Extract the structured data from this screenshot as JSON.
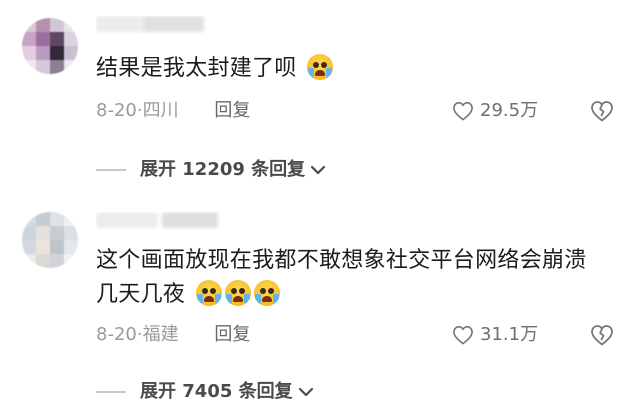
{
  "comments": [
    {
      "text": "结果是我太封建了呗",
      "date": "8-20",
      "location": "四川",
      "reply_label": "回复",
      "likes": "29.5万",
      "expand_label": "展开 12209 条回复",
      "emoji_count": 1
    },
    {
      "text": "这个画面放现在我都不敢想象社交平台网络会崩溃几天几夜",
      "date": "8-20",
      "location": "福建",
      "reply_label": "回复",
      "likes": "31.1万",
      "expand_label": "展开 7405 条回复",
      "emoji_count": 3
    }
  ],
  "separator": "·",
  "colors": {
    "text": "#1c1c1c",
    "meta": "#9a9a9a",
    "expand": "#4a4a4a"
  },
  "icons": {
    "like": "heart-outline-icon",
    "dislike": "broken-heart-icon",
    "expand": "chevron-down-icon",
    "emoji": "crying-face-emoji"
  }
}
